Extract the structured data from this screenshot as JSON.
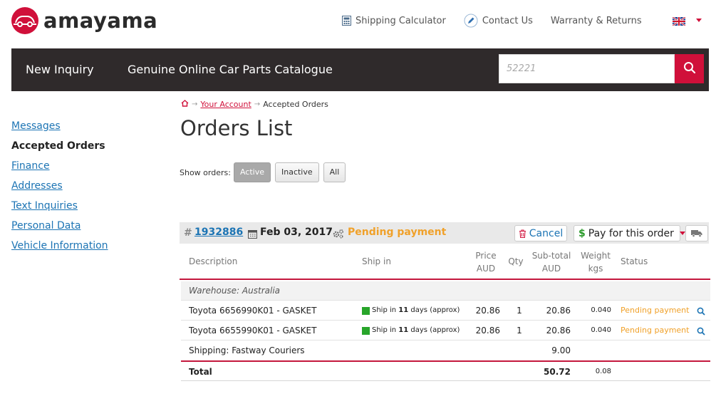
{
  "brand": {
    "name": "amayama",
    "accent": "#d0103a"
  },
  "top_links": [
    {
      "label": "Shipping Calculator",
      "icon": "calculator-icon"
    },
    {
      "label": "Contact Us",
      "icon": "pencil-icon"
    },
    {
      "label": "Warranty & Returns",
      "icon": ""
    }
  ],
  "language": {
    "icon": "uk-flag-icon"
  },
  "nav": {
    "items": [
      "New Inquiry",
      "Genuine Online Car Parts Catalogue"
    ],
    "search_placeholder": "52221"
  },
  "sidebar": {
    "items": [
      {
        "label": "Messages",
        "active": false
      },
      {
        "label": "Accepted Orders",
        "active": true
      },
      {
        "label": "Finance",
        "active": false
      },
      {
        "label": "Addresses",
        "active": false
      },
      {
        "label": "Text Inquiries",
        "active": false
      },
      {
        "label": "Personal Data",
        "active": false
      },
      {
        "label": "Vehicle Information",
        "active": false
      }
    ]
  },
  "breadcrumb": {
    "account": "Your Account",
    "current": "Accepted Orders"
  },
  "page_title": "Orders List",
  "filter": {
    "label": "Show orders:",
    "options": [
      "Active",
      "Inactive",
      "All"
    ],
    "selected": "Active"
  },
  "order": {
    "hash": "#",
    "number": "1932886",
    "date": "Feb 03, 2017",
    "status": "Pending payment",
    "cancel_label": "Cancel",
    "pay_label": "Pay for this order",
    "pay_symbol": "$"
  },
  "table": {
    "headers": {
      "description": "Description",
      "ship_in": "Ship in",
      "price_1": "Price",
      "price_2": "AUD",
      "qty": "Qty",
      "subtotal_1": "Sub-total",
      "subtotal_2": "AUD",
      "weight_1": "Weight",
      "weight_2": "kgs",
      "status": "Status"
    },
    "warehouse": "Warehouse: Australia",
    "rows": [
      {
        "description": "Toyota 6656990K01 - GASKET",
        "ship_pre": "Ship in",
        "ship_days": "11",
        "ship_post": "days (approx)",
        "price": "20.86",
        "qty": "1",
        "subtotal": "20.86",
        "weight": "0.040",
        "status": "Pending payment"
      },
      {
        "description": "Toyota 6655990K01 - GASKET",
        "ship_pre": "Ship in",
        "ship_days": "11",
        "ship_post": "days (approx)",
        "price": "20.86",
        "qty": "1",
        "subtotal": "20.86",
        "weight": "0.040",
        "status": "Pending payment"
      }
    ],
    "shipping": {
      "label": "Shipping: Fastway Couriers",
      "subtotal": "9.00"
    },
    "total": {
      "label": "Total",
      "subtotal": "50.72",
      "weight": "0.08"
    }
  }
}
